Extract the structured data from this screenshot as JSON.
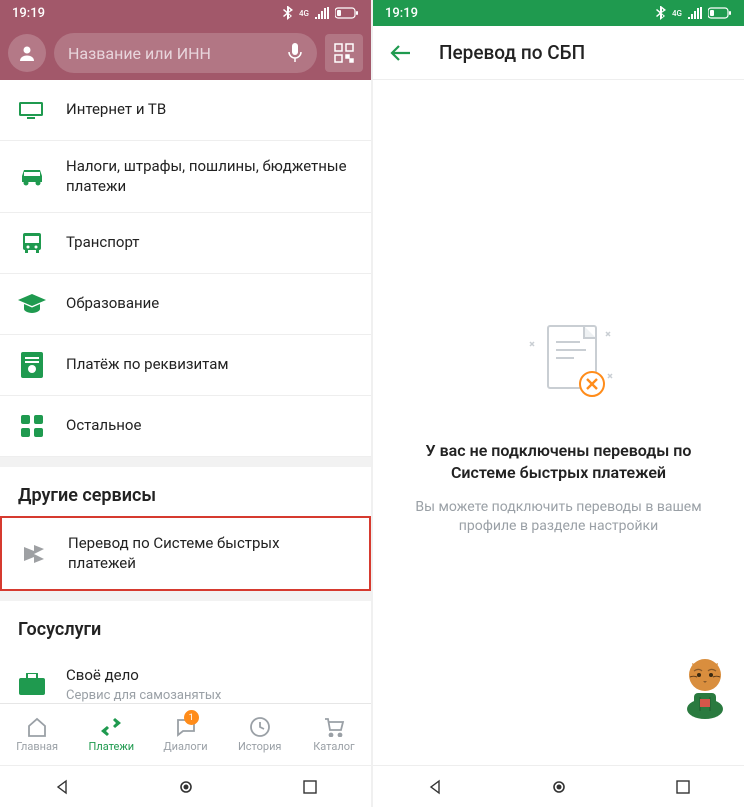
{
  "status": {
    "time": "19:19"
  },
  "left": {
    "search_placeholder": "Название или ИНН",
    "categories": [
      {
        "label": "Интернет и ТВ"
      },
      {
        "label": "Налоги, штрафы, пошлины, бюджетные платежи"
      },
      {
        "label": "Транспорт"
      },
      {
        "label": "Образование"
      },
      {
        "label": "Платёж по реквизитам"
      },
      {
        "label": "Остальное"
      }
    ],
    "section_other": "Другие сервисы",
    "sbp_row": "Перевод по Системе быстрых платежей",
    "section_gov": "Госуслуги",
    "gov_row": {
      "title": "Своё дело",
      "sub": "Сервис для самозанятых"
    },
    "nav": {
      "home": "Главная",
      "payments": "Платежи",
      "dialogs": "Диалоги",
      "dialogs_badge": "1",
      "history": "История",
      "catalog": "Каталог"
    }
  },
  "right": {
    "title": "Перевод по СБП",
    "empty_title": "У вас не подключены переводы по Системе быстрых платежей",
    "empty_sub": "Вы можете подключить переводы в вашем профиле в разделе настройки"
  }
}
